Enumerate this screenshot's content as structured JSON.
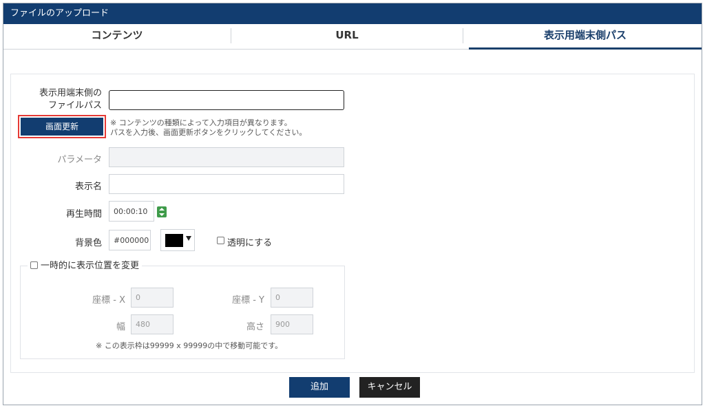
{
  "dialog": {
    "title": "ファイルのアップロード"
  },
  "tabs": [
    {
      "label": "コンテンツ"
    },
    {
      "label": "URL"
    },
    {
      "label": "表示用端末側パス"
    }
  ],
  "form": {
    "path_label_line1": "表示用端末側の",
    "path_label_line2": "ファイルパス",
    "path_value": "",
    "update_button": "画面更新",
    "note_line1": "※ コンテンツの種類によって入力項目が異なります。",
    "note_line2": "パスを入力後、画面更新ボタンをクリックしてください。",
    "param_label": "パラメータ",
    "param_value": "",
    "display_name_label": "表示名",
    "display_name_value": "",
    "play_time_label": "再生時間",
    "play_time_value": "00:00:10",
    "bg_color_label": "背景色",
    "bg_color_value": "#000000",
    "bg_swatch_color": "#000000",
    "transparent_label": "透明にする"
  },
  "position": {
    "legend": "一時的に表示位置を変更",
    "x_label": "座標 - X",
    "x_value": "0",
    "y_label": "座標 - Y",
    "y_value": "0",
    "width_label": "幅",
    "width_value": "480",
    "height_label": "高さ",
    "height_value": "900",
    "note": "※ この表示枠は99999 x 99999の中で移動可能です。"
  },
  "footer": {
    "add_button": "追加",
    "cancel_button": "キャンセル"
  },
  "colors": {
    "accent": "#123d70",
    "highlight": "#e53935"
  }
}
